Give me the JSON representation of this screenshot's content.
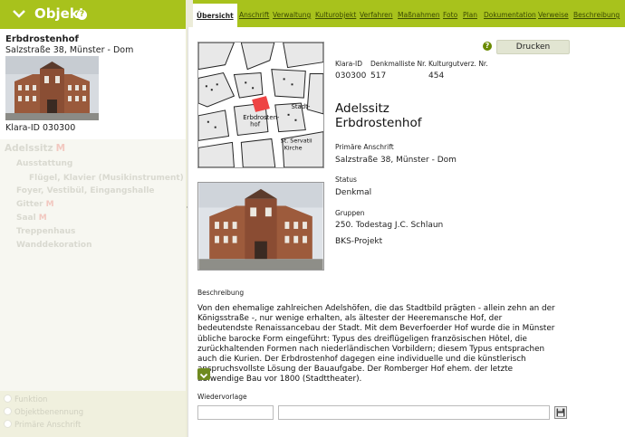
{
  "left_panel": {
    "header_title": "Objekt",
    "object": {
      "name": "Erbdrostenhof",
      "address": "Salzstraße 38, Münster - Dom",
      "klara_id": "Klara-ID 030300"
    },
    "tree": [
      {
        "label": "Adelssitz",
        "marker": "M",
        "level": 0
      },
      {
        "label": "Ausstattung",
        "marker": "",
        "level": 1
      },
      {
        "label": "Flügel, Klavier (Musikinstrument)",
        "marker": "",
        "level": 2
      },
      {
        "label": "Foyer, Vestibül, Eingangshalle",
        "marker": "",
        "level": 1
      },
      {
        "label": "Gitter",
        "marker": "M",
        "level": 1
      },
      {
        "label": "Saal",
        "marker": "M",
        "level": 1
      },
      {
        "label": "Treppenhaus",
        "marker": "",
        "level": 1
      },
      {
        "label": "Wanddekoration",
        "marker": "",
        "level": 1
      }
    ],
    "search_modes": [
      "Funktion",
      "Objektbenennung",
      "Primäre Anschrift"
    ]
  },
  "tabs": [
    {
      "label": "Übersicht",
      "active": true
    },
    {
      "label": "Anschrift",
      "active": false
    },
    {
      "label": "Verwaltung",
      "active": false
    },
    {
      "label": "Kulturobjekt",
      "active": false
    },
    {
      "label": "Verfahren",
      "active": false
    },
    {
      "label": "Maßnahmen",
      "active": false
    },
    {
      "label": "Foto",
      "active": false
    },
    {
      "label": "Plan",
      "active": false
    },
    {
      "label": "Dokumentation",
      "active": false
    },
    {
      "label": "Verweise",
      "active": false
    },
    {
      "label": "Beschreibung",
      "active": false
    }
  ],
  "main": {
    "print_label": "Drucken",
    "ids": {
      "klara_label": "Klara-ID",
      "klara_value": "030300",
      "denkmal_label": "Denkmalliste Nr.",
      "denkmal_value": "517",
      "kultur_label": "Kulturgutverz. Nr.",
      "kultur_value": "454"
    },
    "title_line1": "Adelssitz",
    "title_line2": "Erbdrostenhof",
    "address_label": "Primäre Anschrift",
    "address_value": "Salzstraße 38, Münster - Dom",
    "status_label": "Status",
    "status_value": "Denkmal",
    "groups_label": "Gruppen",
    "groups": [
      "250. Todestag J.C. Schlaun",
      "BKS-Projekt"
    ],
    "map_labels": {
      "erbdrosten": "Erbdrosten-",
      "hof": "hof",
      "st_servatii": "St. Servatii",
      "kirche": "Kirche",
      "stadt": "Stadt-"
    },
    "description_label": "Beschreibung",
    "description_text": "Von den ehemalige zahlreichen Adelshöfen, die das Stadtbild prägten - allein zehn an der Königsstraße -, nur wenige erhalten, als ältester der Heeremansche Hof, der bedeutendste Renaissancebau der Stadt. Mit dem Beverfoerder Hof wurde die in Münster übliche barocke Form eingeführt: Typus des dreiflügeligen französischen Hôtel, die zurückhaltenden Formen nach niederländischen Vorbildern; diesem Typus entsprachen auch die Kurien. Der Erbdrostenhof dagegen eine individuelle und die künstlerisch anspruchsvollste Lösung der Bauaufgabe. Der Romberger Hof ehem. der letzte aufwendige Bau vor 1800 (Stadttheater).",
    "wiedervorlage_label": "Wiedervorlage",
    "wiedervorlage_date": "",
    "wiedervorlage_text": ""
  },
  "colors": {
    "accent": "#a8c21c",
    "tab_link": "#3b4a00",
    "button": "#6f8a20"
  },
  "icons": {
    "collapse": "chevron-down-icon",
    "help": "help-icon",
    "calendar": "calendar-icon",
    "save": "save-icon"
  }
}
